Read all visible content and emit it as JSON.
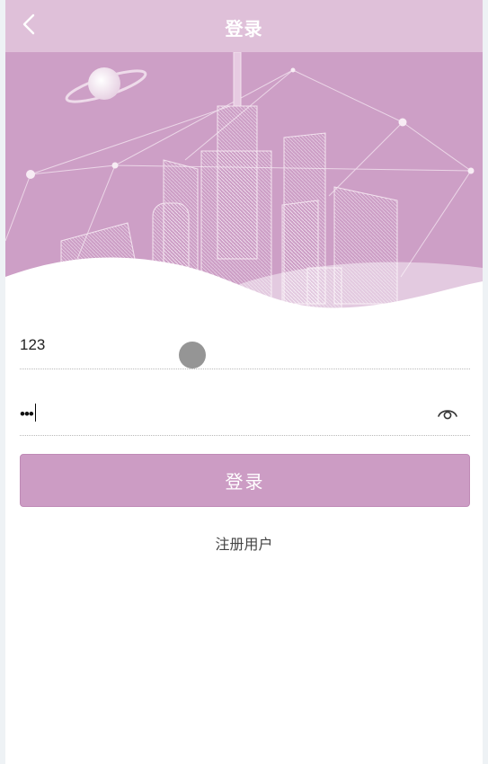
{
  "header": {
    "title": "登录",
    "back_icon": "chevron-left-icon"
  },
  "form": {
    "username_value": "123",
    "password_mask": "•••",
    "password_visibility_icon": "eye-icon"
  },
  "actions": {
    "login_label": "登录",
    "register_label": "注册用户"
  },
  "colors": {
    "header_bg": "#dfc0d9",
    "hero_bg": "#cd9fc6",
    "button_bg": "#cc9cc4"
  }
}
